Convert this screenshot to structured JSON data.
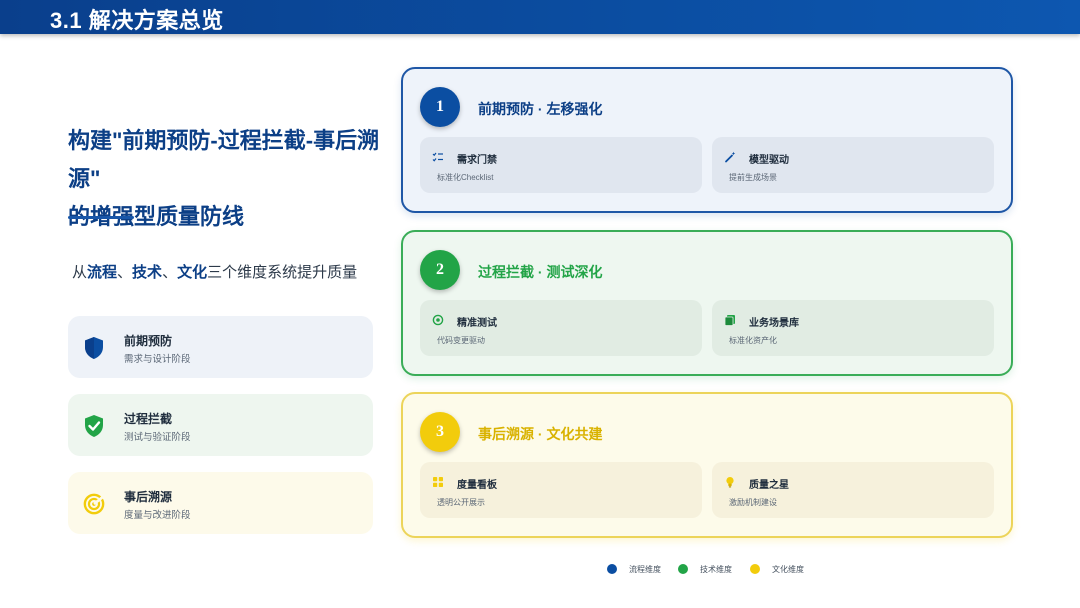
{
  "header": {
    "title": "3.1 解决方案总览"
  },
  "headline": {
    "line1": "构建\"前期预防-过程拦截-事后溯源\"",
    "line2": "的增强型质量防线"
  },
  "subline": {
    "prefix": "从",
    "w1": "流程",
    "sep1": "、",
    "w2": "技术",
    "sep2": "、",
    "w3": "文化",
    "suffix": "三个维度系统提升质量"
  },
  "stages": [
    {
      "title": "前期预防",
      "desc": "需求与设计阶段",
      "icon": "shield-icon",
      "color": "#0b4ea2"
    },
    {
      "title": "过程拦截",
      "desc": "测试与验证阶段",
      "icon": "shield-check-icon",
      "color": "#22a447"
    },
    {
      "title": "事后溯源",
      "desc": "度量与改进阶段",
      "icon": "radar-icon",
      "color": "#f2cc0c"
    }
  ],
  "cards": [
    {
      "number": "1",
      "title": "前期预防 · 左移强化",
      "color": "#0b4ea2",
      "items": [
        {
          "title": "需求门禁",
          "desc": "标准化Checklist",
          "icon": "checklist-icon"
        },
        {
          "title": "模型驱动",
          "desc": "提前生成场景",
          "icon": "magic-wand-icon"
        }
      ]
    },
    {
      "number": "2",
      "title": "过程拦截 · 测试深化",
      "color": "#22a447",
      "items": [
        {
          "title": "精准测试",
          "desc": "代码变更驱动",
          "icon": "target-icon"
        },
        {
          "title": "业务场景库",
          "desc": "标准化资产化",
          "icon": "library-icon"
        }
      ]
    },
    {
      "number": "3",
      "title": "事后溯源 · 文化共建",
      "color": "#f2cc0c",
      "items": [
        {
          "title": "度量看板",
          "desc": "透明公开展示",
          "icon": "dashboard-icon"
        },
        {
          "title": "质量之星",
          "desc": "激励机制建设",
          "icon": "lightbulb-icon"
        }
      ]
    }
  ],
  "legend": [
    {
      "label": "流程维度",
      "color": "#0b4ea2"
    },
    {
      "label": "技术维度",
      "color": "#22a447"
    },
    {
      "label": "文化维度",
      "color": "#f2cc0c"
    }
  ]
}
